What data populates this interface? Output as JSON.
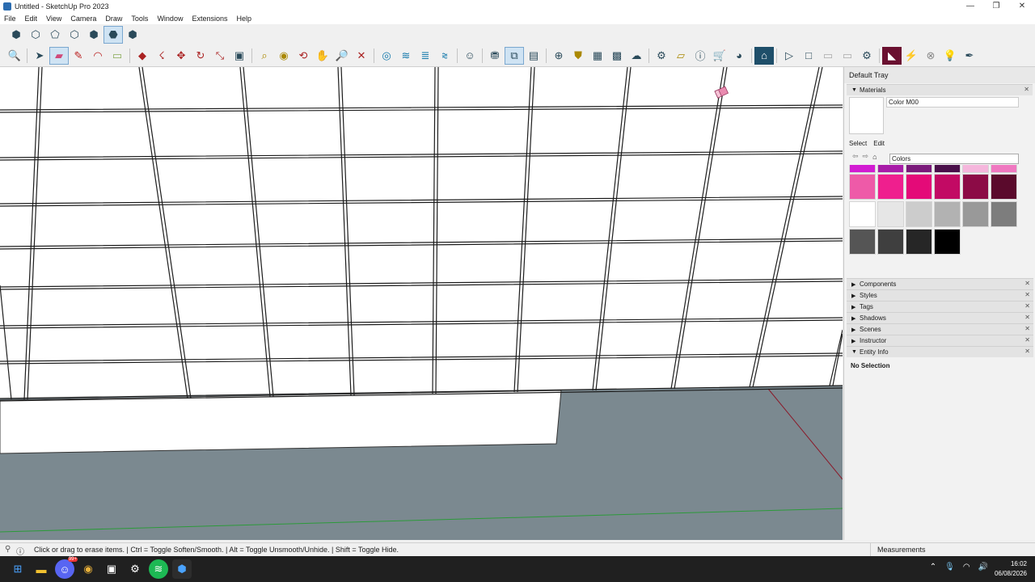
{
  "window": {
    "title": "Untitled - SketchUp Pro 2023",
    "min": "—",
    "max": "❐",
    "close": "✕"
  },
  "menu": [
    "File",
    "Edit",
    "View",
    "Camera",
    "Draw",
    "Tools",
    "Window",
    "Extensions",
    "Help"
  ],
  "toolbar_icons": {
    "views": [
      "iso-view-icon",
      "top-view-icon",
      "front-view-icon",
      "right-view-icon",
      "back-view-icon",
      "left-view-icon",
      "bottom-view-icon"
    ],
    "main": [
      "zoom-icon",
      "select-icon",
      "eraser-icon",
      "pencil-icon",
      "arc-icon",
      "rectangle-icon",
      "push-pull-icon",
      "follow-me-icon",
      "move-icon",
      "rotate-icon",
      "scale-icon",
      "offset-icon",
      "tape-measure-icon",
      "paint-bucket-icon",
      "orbit-icon",
      "pan-icon",
      "zoom-window-icon",
      "zoom-extents-icon",
      "section-plane-icon",
      "layers-icon",
      "tags-icon",
      "solid-tools-icon",
      "account-icon",
      "extension-warehouse-icon",
      "components-icon",
      "3d-warehouse-icon",
      "add-location-icon",
      "geo-icon",
      "layout-icon",
      "texture-icon",
      "cloud-icon",
      "settings-icon",
      "scenes-icon",
      "info-icon",
      "cart-icon",
      "user-icon",
      "trimble-icon",
      "play-icon",
      "stop-icon",
      "camera-icon",
      "video-icon",
      "gear-icon",
      "extension-icon",
      "lightning-icon",
      "close-circle-icon",
      "bulb-icon",
      "pen-icon"
    ]
  },
  "tray": {
    "title": "Default Tray",
    "materials_label": "Materials",
    "material_name": "Color M00",
    "tab_select": "Select",
    "tab_edit": "Edit",
    "library": "Colors",
    "swatch_colors": [
      [
        "#d21cd2",
        "#a81ca8",
        "#7a1a7a",
        "#4a0f4a",
        "#f5b6dc",
        "#ef78c0"
      ],
      [
        "#ee5aa8",
        "#ef1f8e",
        "#e40a78",
        "#c20a64",
        "#8c0b46",
        "#5a0a2c"
      ],
      [
        "#ffffff",
        "#e6e6e6",
        "#cccccc",
        "#b2b2b2",
        "#999999",
        "#7d7d7d"
      ],
      [
        "#555555",
        "#3f3f3f",
        "#262626",
        "#000000"
      ]
    ],
    "panels": [
      "Components",
      "Styles",
      "Tags",
      "Shadows",
      "Scenes",
      "Instructor",
      "Entity Info"
    ],
    "entity_info": "No Selection"
  },
  "status": {
    "text": "Click or drag to erase items. | Ctrl = Toggle Soften/Smooth. | Alt = Toggle Unsmooth/Unhide. | Shift = Toggle Hide.",
    "measurements_label": "Measurements"
  },
  "taskbar": {
    "time": "16:02",
    "date": "06/08/2026",
    "badge": "99+"
  },
  "colors": {
    "ground": "#7b8990",
    "canvas": "#ffffff",
    "axis_green": "#2c9a3a",
    "axis_red": "#8a1a2a"
  }
}
